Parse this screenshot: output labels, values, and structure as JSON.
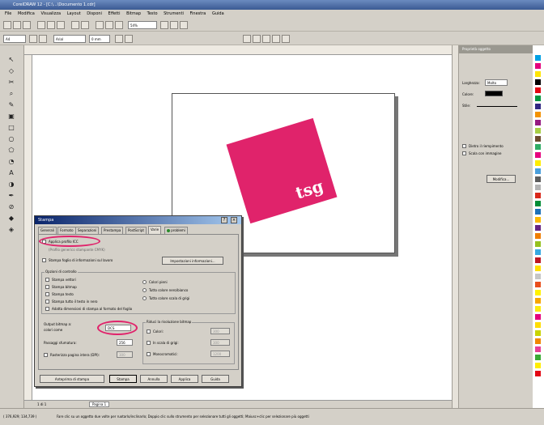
{
  "app": {
    "title": "CorelDRAW 12 - [C:\\...\\Documento 1.cdr]",
    "menu": [
      "File",
      "Modifica",
      "Visualizza",
      "Layout",
      "Disponi",
      "Effetti",
      "Bitmap",
      "Testo",
      "Strumenti",
      "Finestra",
      "Guida"
    ]
  },
  "toolbar": {
    "zoom_value": "54%",
    "font_value": "Arial",
    "size_value": "A4",
    "units_value": "0 mm"
  },
  "docker": {
    "title": "Proprietà oggetto",
    "width_label": "Larghezza:",
    "width_value": "Molto",
    "color_label": "Colore:",
    "style_label": "Stile:",
    "check1": "Dietro il riempimento",
    "check2": "Scala con immagine",
    "button": "Modifica..."
  },
  "logo_text": "tsg",
  "page_tabs": {
    "counter": "1 di 1",
    "tab": "Pagina 1"
  },
  "status": {
    "coords": "( 376,929; 134,739 )",
    "message": "Fare clic su un oggetto due volte per ruotarlo/inclinarlo; Doppio clic sullo strumento per selezionare tutti gli oggetti; Maiusc+clic per selezionare più oggetti"
  },
  "dialog": {
    "title": "Stampa",
    "tabs": [
      "Generali",
      "Formato",
      "Separazioni",
      "Prestampa",
      "PostScript",
      "Varie",
      "problemi"
    ],
    "active_tab": "Varie",
    "apply_icc": "Applica profilo ICC",
    "icc_hint": "(Profilo generico stampante CMYK)",
    "print_job_sheet": "Stampa foglio di informazioni sul lavoro",
    "job_info_button": "Impostazioni informazioni...",
    "proof_group": "Opzioni di controllo",
    "proof_items": [
      "Stampa vettori",
      "Stampa bitmap",
      "Stampa testo",
      "Stampa tutto il testo in nero",
      "Adatta dimensioni di stampa al formato del foglio"
    ],
    "color_options": [
      "Colori pieni",
      "Tutto colore nero/bianco",
      "Tutto colore scala di grigi"
    ],
    "bitmap_label": "Output bitmap a:",
    "bitmap_value": "DCS",
    "bitmap_label2": "colori come",
    "fountain_label": "Passaggi sfumatura:",
    "fountain_value": "256",
    "fountain_check": "Rasterizza pagina intera (DPI):",
    "fountain_dpi": "300",
    "bitmap_group": "Riduci la risoluzione bitmap",
    "res_colori": "Colori:",
    "res_grigi": "In scala di grigi:",
    "res_mono": "Monocromatici:",
    "res_colori_val": "300",
    "res_grigi_val": "300",
    "res_mono_val": "1200",
    "buttons": [
      "Anteprima di stampa",
      "Stampa",
      "Annulla",
      "Applica",
      "Guida"
    ]
  },
  "colors": {
    "accent": "#e0236b",
    "title_bar": "#0a246a",
    "chrome": "#d4d0c8"
  }
}
